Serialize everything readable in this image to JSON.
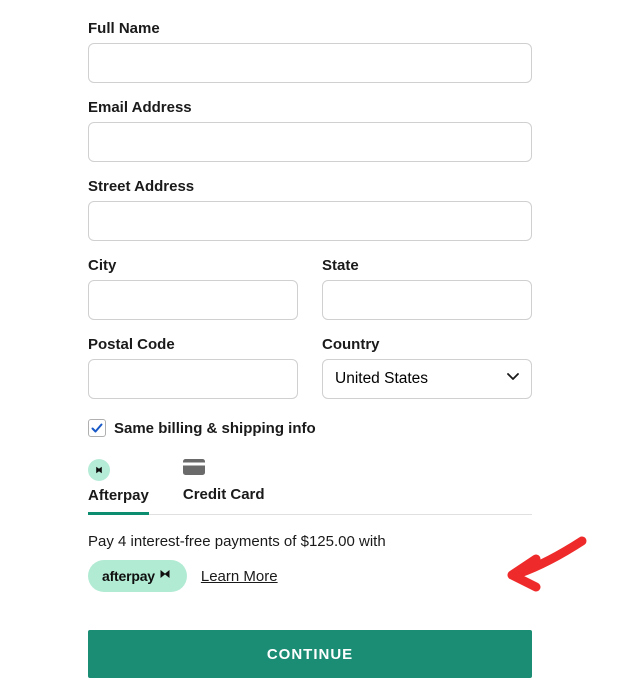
{
  "form": {
    "full_name": {
      "label": "Full Name",
      "value": ""
    },
    "email": {
      "label": "Email Address",
      "value": ""
    },
    "street": {
      "label": "Street Address",
      "value": ""
    },
    "city": {
      "label": "City",
      "value": ""
    },
    "state": {
      "label": "State",
      "value": ""
    },
    "postal": {
      "label": "Postal Code",
      "value": ""
    },
    "country": {
      "label": "Country",
      "value": "United States"
    }
  },
  "same_billing": {
    "checked": true,
    "label": "Same billing & shipping info"
  },
  "tabs": {
    "afterpay": {
      "label": "Afterpay"
    },
    "credit_card": {
      "label": "Credit Card"
    }
  },
  "afterpay": {
    "message": "Pay 4 interest-free payments of $125.00 with",
    "badge": "afterpay",
    "learn_more": "Learn More"
  },
  "continue_label": "CONTINUE",
  "colors": {
    "accent": "#1a8d74",
    "mint": "#b2ebd4"
  }
}
